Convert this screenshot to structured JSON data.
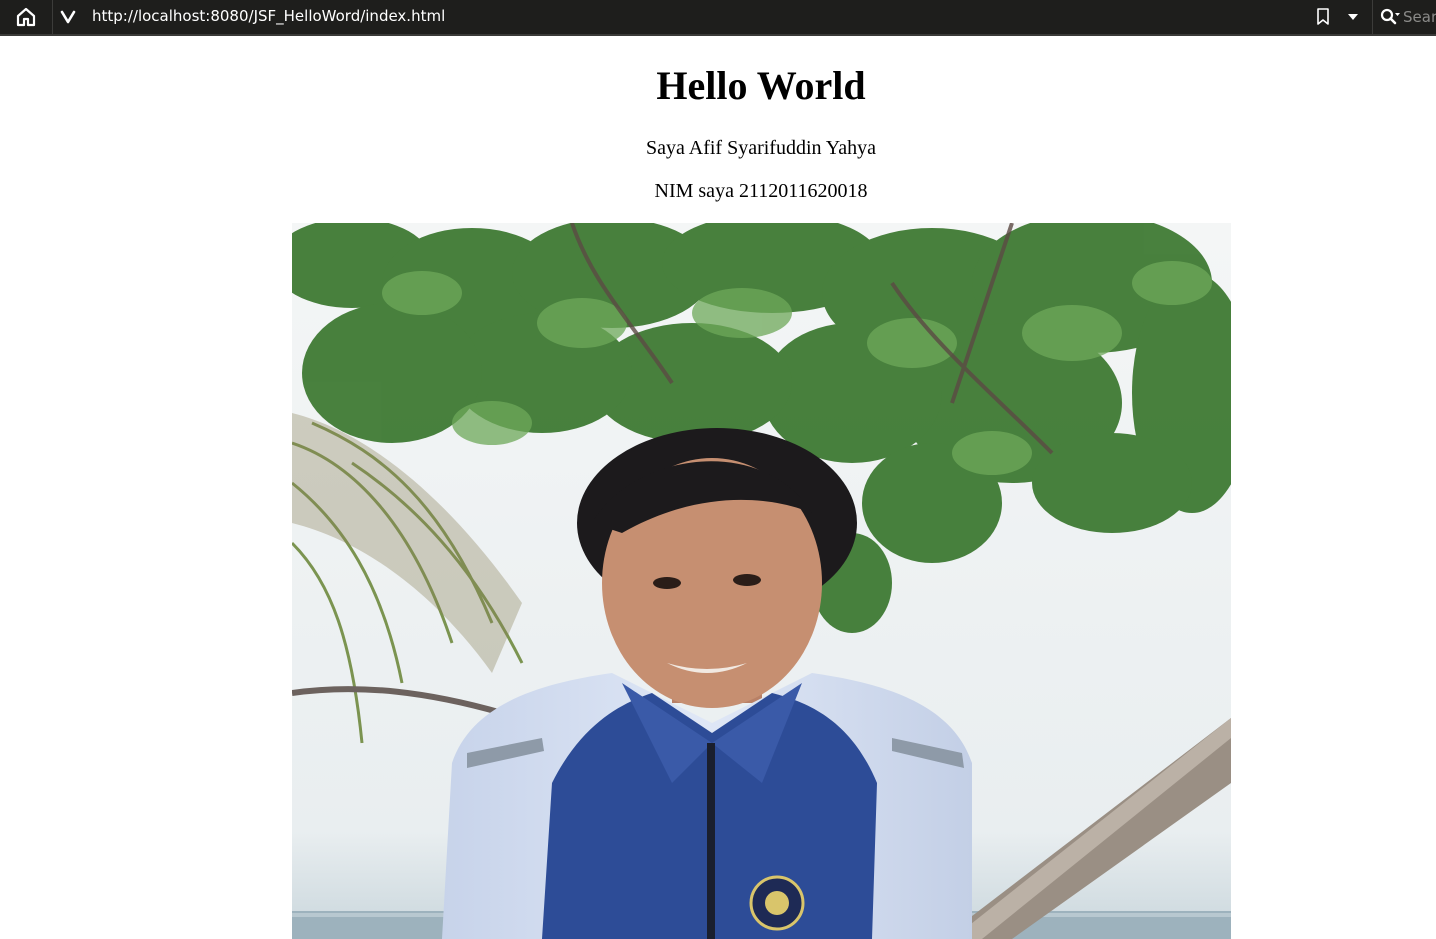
{
  "browser": {
    "url": "http://localhost:8080/JSF_HelloWord/index.html",
    "search_placeholder": "Sear",
    "icons": {
      "home": "home-icon",
      "vivaldi": "vivaldi-logo-icon",
      "bookmark": "bookmark-icon",
      "dropdown": "chevron-down-icon",
      "search": "search-icon"
    }
  },
  "page": {
    "heading": "Hello World",
    "name_line": "Saya Afif Syarifuddin Yahya",
    "nim_line": "NIM saya 2112011620018"
  },
  "colors": {
    "toolbar_bg": "#1e1e1c",
    "page_bg": "#ffffff",
    "text": "#000000"
  }
}
